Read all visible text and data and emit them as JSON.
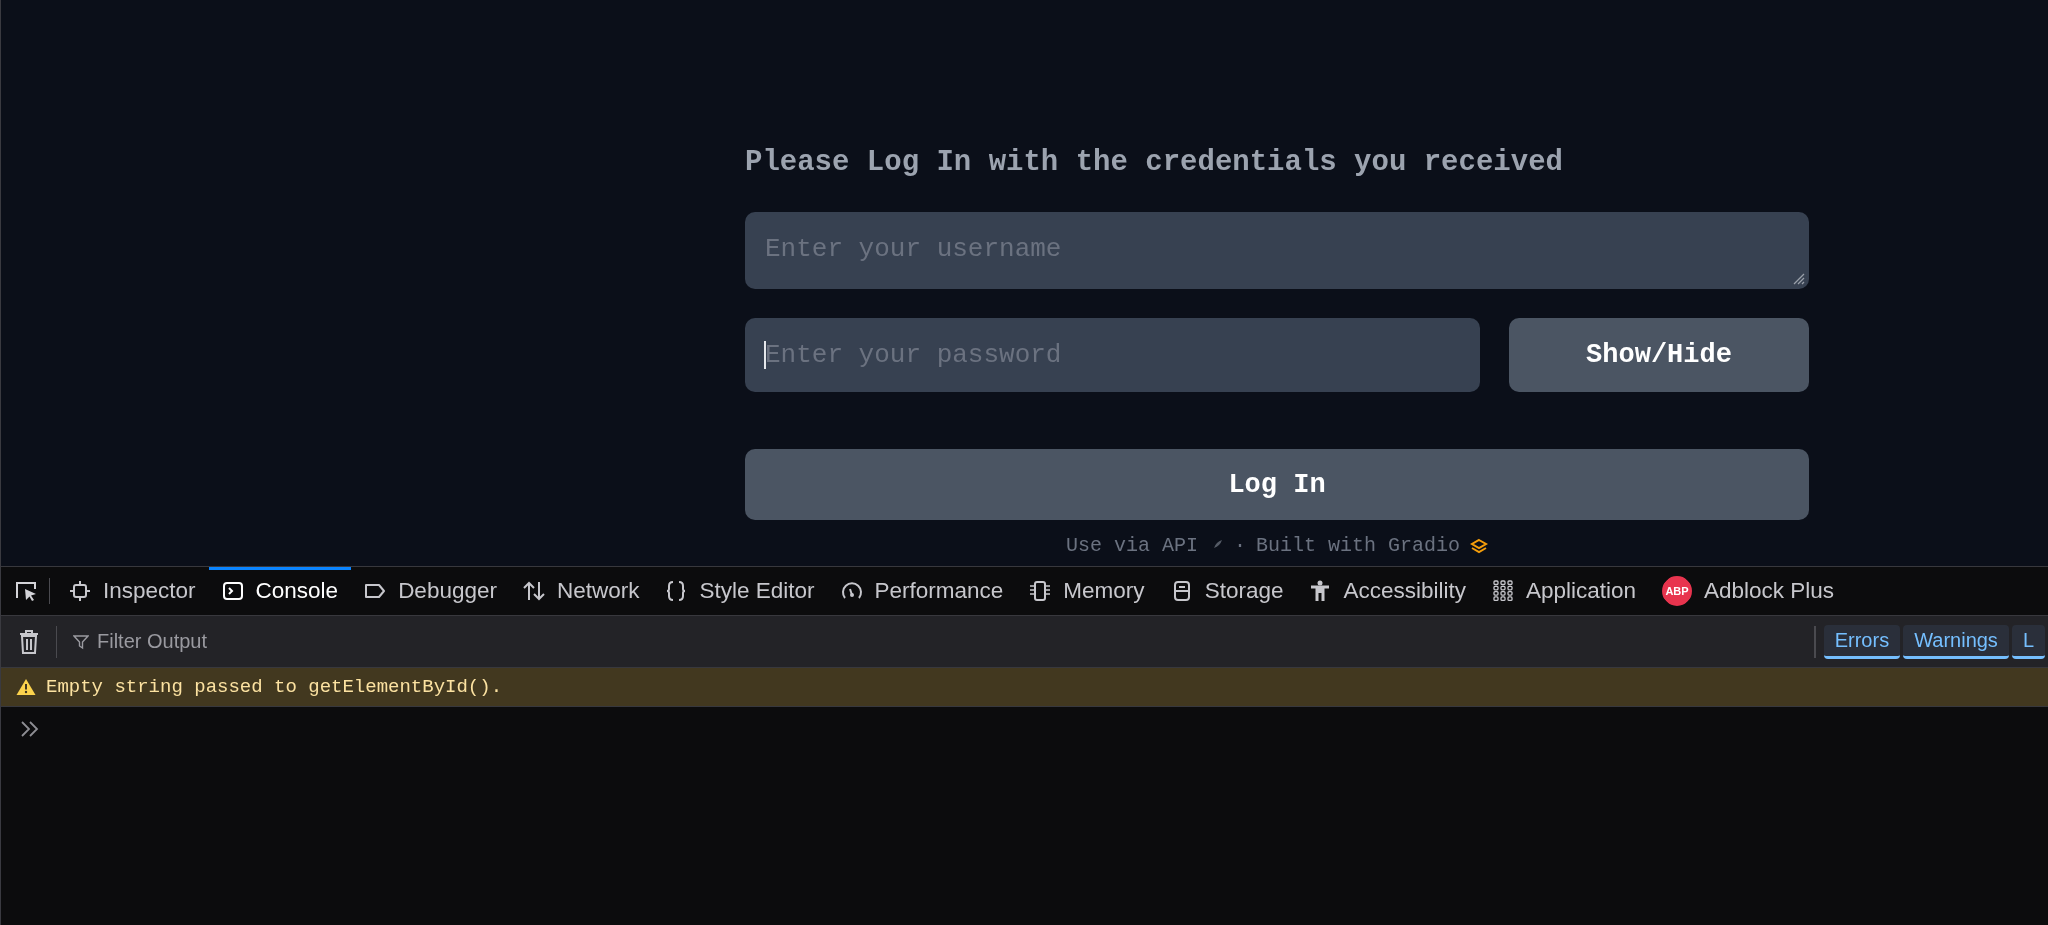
{
  "page": {
    "heading": "Please Log In with the credentials you received",
    "username_field": {
      "placeholder": "Enter your username"
    },
    "password_field": {
      "placeholder": "Enter your password",
      "focused": true
    },
    "show_hide_button": "Show/Hide",
    "login_button": "Log In",
    "footer": {
      "api_link": "Use via API",
      "separator": "·",
      "gradio_link": "Built with Gradio"
    }
  },
  "devtools": {
    "tabs": [
      {
        "label": "Inspector",
        "kind": "inspector",
        "selected": false
      },
      {
        "label": "Console",
        "kind": "console",
        "selected": true
      },
      {
        "label": "Debugger",
        "kind": "debugger",
        "selected": false
      },
      {
        "label": "Network",
        "kind": "network",
        "selected": false
      },
      {
        "label": "Style Editor",
        "kind": "style",
        "selected": false
      },
      {
        "label": "Performance",
        "kind": "performance",
        "selected": false
      },
      {
        "label": "Memory",
        "kind": "memory",
        "selected": false
      },
      {
        "label": "Storage",
        "kind": "storage",
        "selected": false
      },
      {
        "label": "Accessibility",
        "kind": "accessibility",
        "selected": false
      },
      {
        "label": "Application",
        "kind": "application",
        "selected": false
      },
      {
        "label": "Adblock Plus",
        "kind": "extension",
        "badge": "ABP",
        "selected": false
      }
    ],
    "filter": {
      "placeholder": "Filter Output"
    },
    "levels": [
      {
        "label": "Errors",
        "selected": true
      },
      {
        "label": "Warnings",
        "selected": true
      },
      {
        "label": "L",
        "selected": true
      }
    ],
    "messages": [
      {
        "kind": "warning",
        "text": "Empty string passed to getElementById()."
      }
    ]
  }
}
